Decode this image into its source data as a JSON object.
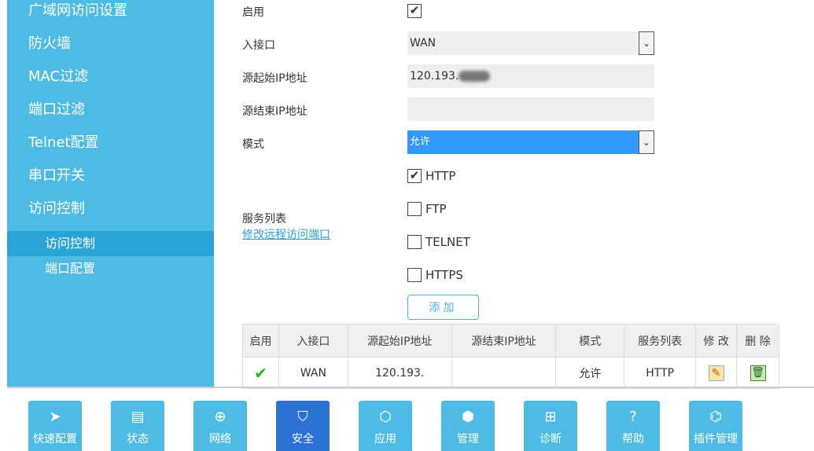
{
  "sidebar": {
    "items": [
      "广域网访问设置",
      "防火墙",
      "MAC过滤",
      "端口过滤",
      "Telnet配置",
      "串口开关",
      "访问控制"
    ],
    "subitems": [
      "访问控制",
      "端口配置"
    ]
  },
  "form": {
    "enable_label": "启用",
    "iface_label": "入接口",
    "iface_value": "WAN",
    "start_ip_label": "源起始IP地址",
    "start_ip_value": "120.193.",
    "end_ip_label": "源结束IP地址",
    "end_ip_value": "",
    "mode_label": "模式",
    "mode_value": "允许",
    "services_label": "服务列表",
    "services_link": "修改远程访问端口",
    "services": [
      {
        "name": "HTTP",
        "checked": true
      },
      {
        "name": "FTP",
        "checked": false
      },
      {
        "name": "TELNET",
        "checked": false
      },
      {
        "name": "HTTPS",
        "checked": false
      }
    ],
    "add_button": "添加"
  },
  "table": {
    "headers": [
      "启用",
      "入接口",
      "源起始IP地址",
      "源结束IP地址",
      "模式",
      "服务列表",
      "修 改",
      "删 除"
    ],
    "rows": [
      {
        "enabled": "✔",
        "iface": "WAN",
        "start_ip": "120.193.",
        "end_ip": "",
        "mode": "允许",
        "services": "HTTP"
      }
    ]
  },
  "nav": [
    {
      "label": "快速配置",
      "icon": "➤"
    },
    {
      "label": "状态",
      "icon": "▤"
    },
    {
      "label": "网络",
      "icon": "⊕"
    },
    {
      "label": "安全",
      "icon": "⛉"
    },
    {
      "label": "应用",
      "icon": "⬡"
    },
    {
      "label": "管理",
      "icon": "⬢"
    },
    {
      "label": "诊断",
      "icon": "⊞"
    },
    {
      "label": "帮助",
      "icon": "?"
    },
    {
      "label": "插件管理",
      "icon": "⌬"
    }
  ],
  "colors": {
    "sidebar": "#4dbbe3",
    "active_nav": "#2c72d6",
    "select_highlight": "#3399ff"
  }
}
